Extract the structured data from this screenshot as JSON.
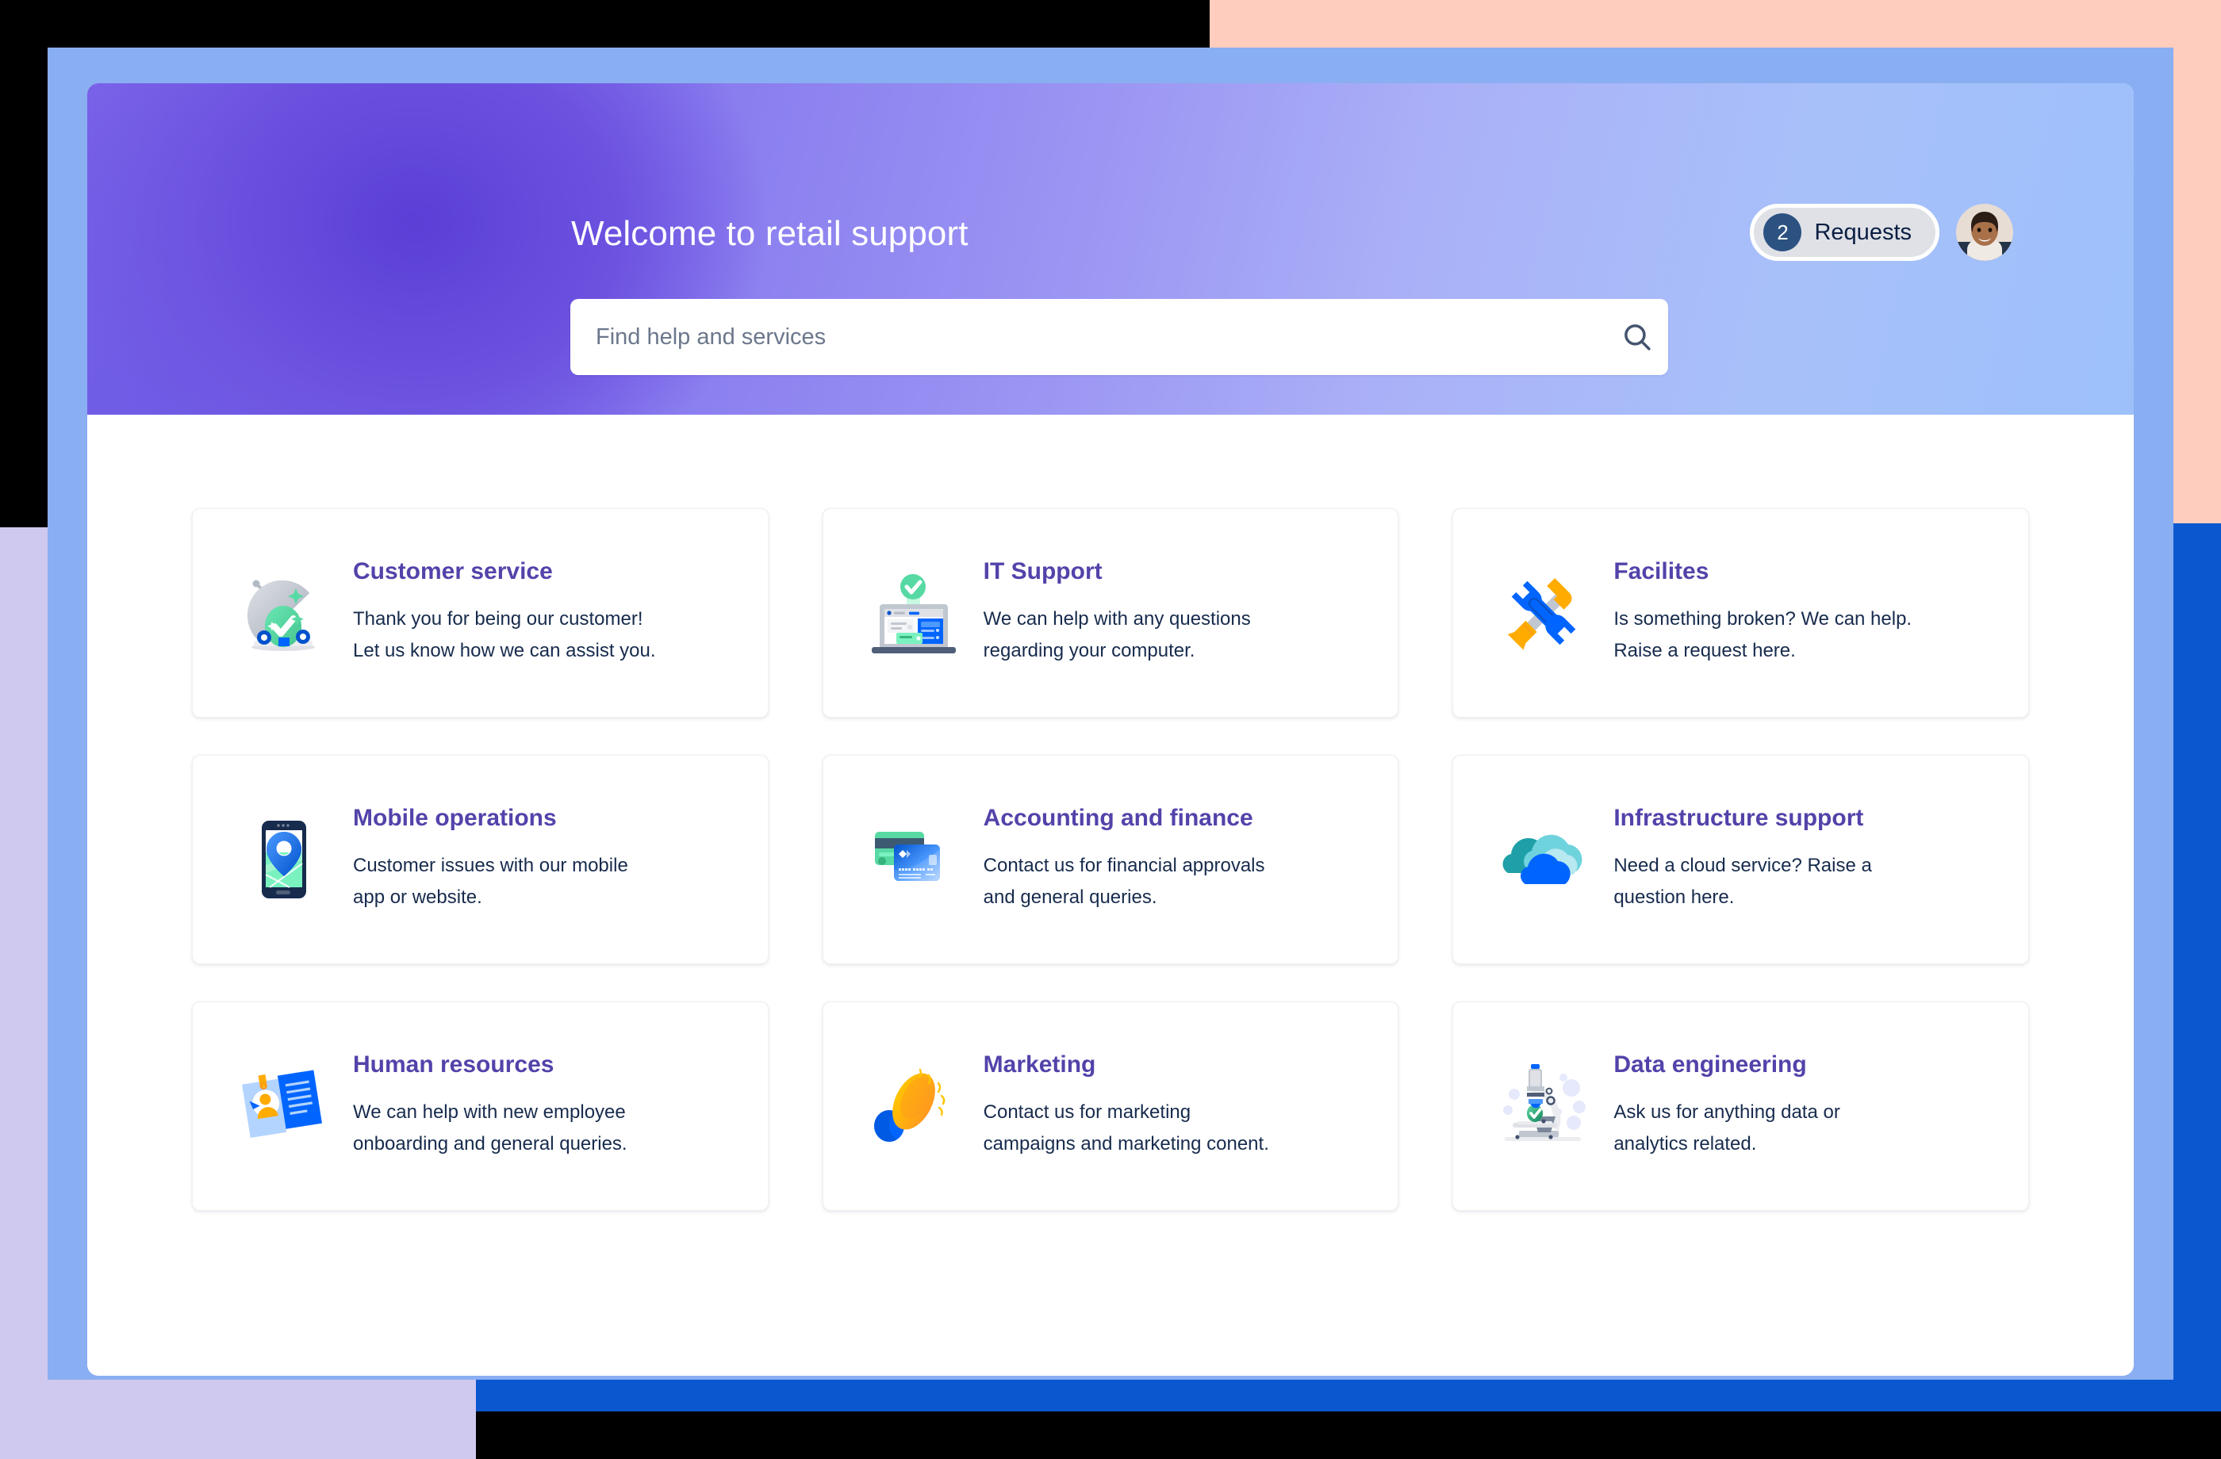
{
  "header": {
    "title": "Welcome to retail support",
    "requests": {
      "count": "2",
      "label": "Requests"
    },
    "avatar_name": "user-avatar",
    "search": {
      "placeholder": "Find help and services",
      "value": "",
      "icon": "search-icon"
    }
  },
  "colors": {
    "card_title": "#5243AA",
    "card_body_text": "#172B4D",
    "badge_bg": "#2C5282",
    "pill_bg": "#DFE1E6",
    "hero_gradient_from": "#7B63E8",
    "hero_gradient_to": "#9DC0FB",
    "deco_peach": "#FFCDBE",
    "deco_royal_blue": "#0B57D0",
    "deco_lavender": "#CFC8EF",
    "deco_cornflower": "#8AAEF2",
    "window_bg": "#FFFFFF"
  },
  "cards": [
    {
      "title": "Customer service",
      "desc_line1": "Thank you for being our customer!",
      "desc_line2": "Let us know how we can assist you.",
      "icon": "service-cloche-checkmark-icon"
    },
    {
      "title": "IT Support",
      "desc_line1": "We can help with any questions",
      "desc_line2": "regarding your computer.",
      "icon": "laptop-check-icon"
    },
    {
      "title": "Facilites",
      "desc_line1": "Is something broken? We can help.",
      "desc_line2": "Raise a request here.",
      "icon": "wrench-hammer-icon"
    },
    {
      "title": "Mobile operations",
      "desc_line1": "Customer issues with our mobile",
      "desc_line2": "app or website.",
      "icon": "phone-map-pin-icon"
    },
    {
      "title": "Accounting and finance",
      "desc_line1": "Contact us for financial approvals",
      "desc_line2": "and general queries.",
      "icon": "credit-cards-icon"
    },
    {
      "title": "Infrastructure support",
      "desc_line1": "Need a cloud service? Raise a",
      "desc_line2": "question here.",
      "icon": "clouds-icon"
    },
    {
      "title": "Human resources",
      "desc_line1": "We can help with new employee",
      "desc_line2": "onboarding and general queries.",
      "icon": "id-badge-person-icon"
    },
    {
      "title": "Marketing",
      "desc_line1": "Contact us for marketing",
      "desc_line2": "campaigns and marketing conent.",
      "icon": "megaphone-icon"
    },
    {
      "title": "Data engineering",
      "desc_line1": "Ask us for anything data or",
      "desc_line2": "analytics related.",
      "icon": "microscope-icon"
    }
  ]
}
